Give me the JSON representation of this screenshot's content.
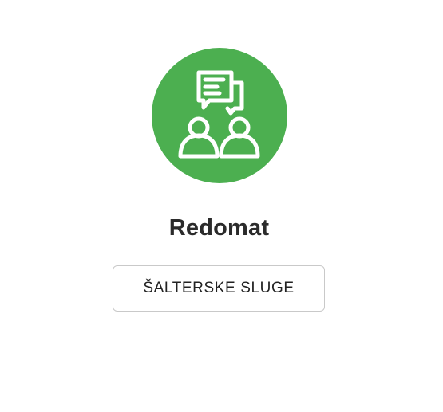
{
  "service": {
    "icon": "people-chat-icon",
    "icon_background": "#4caf50",
    "title": "Redomat"
  },
  "actions": {
    "counter_services_label": "ŠALTERSKE SLUGE"
  }
}
